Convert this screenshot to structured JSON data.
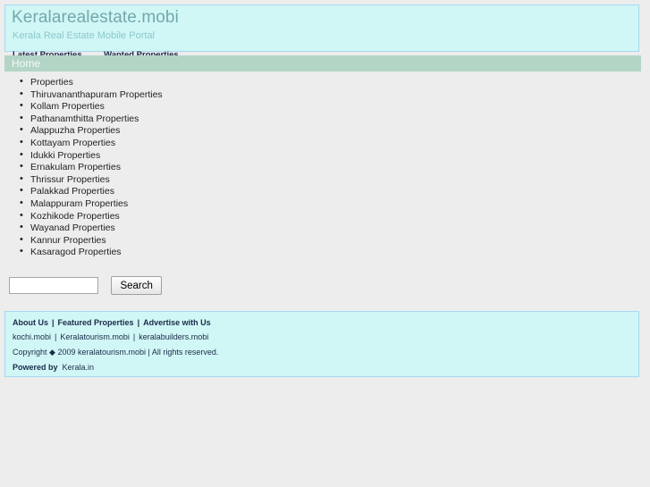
{
  "window": {
    "background_color": "#ededed"
  },
  "header": {
    "title": "Keralarealestate.mobi",
    "subtitle": "Kerala Real Estate Mobile Portal",
    "title_color": "#73a8ad",
    "subtitle_color": "#8dc7cd",
    "panel_color": "#d0f7f5",
    "border_color": "#a8d8ef",
    "nav": [
      {
        "label": "Latest Properties"
      },
      {
        "label": "Wanted Properties"
      }
    ]
  },
  "breadcrumb_bar": {
    "label": "Home",
    "background_color": "#b3d5c6",
    "text_color": "#f4fbf8"
  },
  "main": {
    "list_items": [
      {
        "label": "Properties"
      },
      {
        "label": "Thiruvananthapuram Properties"
      },
      {
        "label": "Kollam Properties"
      },
      {
        "label": "Pathanamthitta Properties"
      },
      {
        "label": "Alappuzha Properties"
      },
      {
        "label": "Kottayam Properties"
      },
      {
        "label": "Idukki Properties"
      },
      {
        "label": "Ernakulam Properties"
      },
      {
        "label": "Thrissur Properties"
      },
      {
        "label": "Palakkad Properties"
      },
      {
        "label": "Malappuram Properties"
      },
      {
        "label": "Kozhikode Properties"
      },
      {
        "label": "Wayanad Properties"
      },
      {
        "label": "Kannur Properties"
      },
      {
        "label": "Kasaragod Properties"
      }
    ]
  },
  "search": {
    "value": "",
    "placeholder": "",
    "button_label": "Search"
  },
  "footer": {
    "panel_color": "#d0f7f5",
    "border_color": "#a8d8ef",
    "text_color": "#1b2a4a",
    "row1": {
      "link1": "About Us",
      "sep1": "|",
      "link2": "Featured Properties",
      "sep2": "|",
      "link3": "Advertise with Us"
    },
    "row2": {
      "link1": "kochi.mobi",
      "sep1": "|",
      "link2": "Keralatourism.mobi",
      "sep2": "|",
      "link3": "keralabuilders.mobi"
    },
    "row3": {
      "prefix": "Copyright",
      "symbol": "◆",
      "suffix": "2009 keralatourism.mobi | All rights reserved."
    },
    "row4": {
      "prefix": "Powered by",
      "link": "Kerala.in"
    }
  }
}
